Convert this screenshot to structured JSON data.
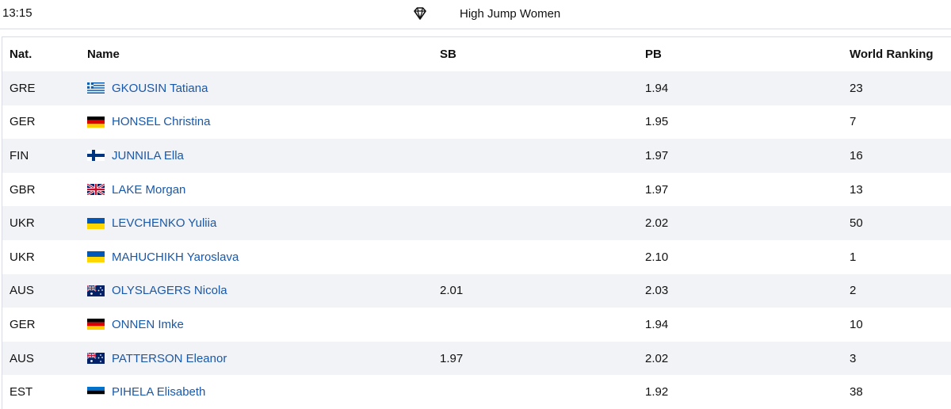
{
  "header": {
    "time": "13:15",
    "event_title": "High Jump Women",
    "event_icon": "diamond-icon"
  },
  "table": {
    "columns": [
      "Nat.",
      "Name",
      "SB",
      "PB",
      "World Ranking"
    ],
    "rows": [
      {
        "nat": "GRE",
        "name": "GKOUSIN Tatiana",
        "sb": "",
        "pb": "1.94",
        "wr": "23",
        "flag": "greece-flag"
      },
      {
        "nat": "GER",
        "name": "HONSEL Christina",
        "sb": "",
        "pb": "1.95",
        "wr": "7",
        "flag": "germany-flag"
      },
      {
        "nat": "FIN",
        "name": "JUNNILA Ella",
        "sb": "",
        "pb": "1.97",
        "wr": "16",
        "flag": "finland-flag"
      },
      {
        "nat": "GBR",
        "name": "LAKE Morgan",
        "sb": "",
        "pb": "1.97",
        "wr": "13",
        "flag": "uk-flag"
      },
      {
        "nat": "UKR",
        "name": "LEVCHENKO Yuliia",
        "sb": "",
        "pb": "2.02",
        "wr": "50",
        "flag": "ukraine-flag"
      },
      {
        "nat": "UKR",
        "name": "MAHUCHIKH Yaroslava",
        "sb": "",
        "pb": "2.10",
        "wr": "1",
        "flag": "ukraine-flag"
      },
      {
        "nat": "AUS",
        "name": "OLYSLAGERS Nicola",
        "sb": "2.01",
        "pb": "2.03",
        "wr": "2",
        "flag": "australia-flag"
      },
      {
        "nat": "GER",
        "name": "ONNEN Imke",
        "sb": "",
        "pb": "1.94",
        "wr": "10",
        "flag": "germany-flag"
      },
      {
        "nat": "AUS",
        "name": "PATTERSON Eleanor",
        "sb": "1.97",
        "pb": "2.02",
        "wr": "3",
        "flag": "australia-flag"
      },
      {
        "nat": "EST",
        "name": "PIHELA Elisabeth",
        "sb": "",
        "pb": "1.92",
        "wr": "38",
        "flag": "estonia-flag"
      }
    ]
  },
  "colors": {
    "link": "#1a58a8",
    "row_alt": "#f2f3f6",
    "border": "#d9dde3"
  }
}
